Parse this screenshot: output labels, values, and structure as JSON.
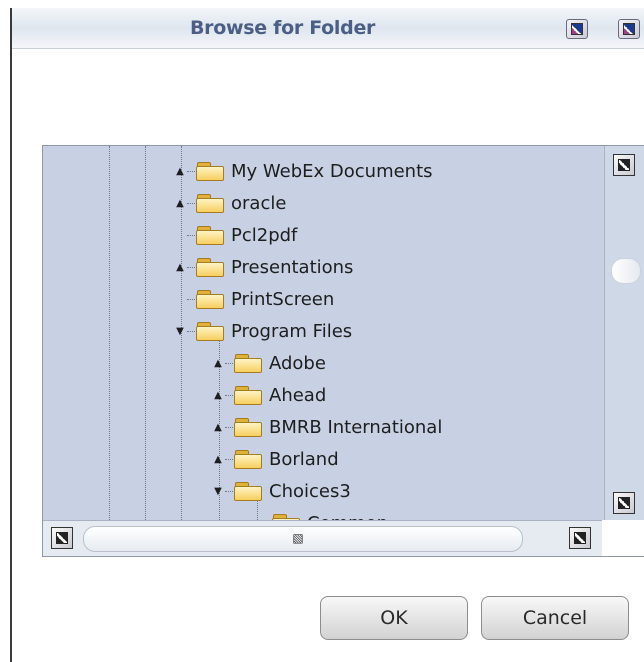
{
  "dialog": {
    "title": "Browse for Folder",
    "titlebar_buttons": [
      "minimize-icon",
      "close-icon"
    ]
  },
  "tree": {
    "items": [
      {
        "label": "My WebEx Documents",
        "depth": 0,
        "expander": "collapsed"
      },
      {
        "label": "oracle",
        "depth": 0,
        "expander": "collapsed"
      },
      {
        "label": "Pcl2pdf",
        "depth": 0,
        "expander": "none"
      },
      {
        "label": "Presentations",
        "depth": 0,
        "expander": "collapsed"
      },
      {
        "label": "PrintScreen",
        "depth": 0,
        "expander": "none"
      },
      {
        "label": "Program Files",
        "depth": 0,
        "expander": "expanded"
      },
      {
        "label": "Adobe",
        "depth": 1,
        "expander": "collapsed"
      },
      {
        "label": "Ahead",
        "depth": 1,
        "expander": "collapsed"
      },
      {
        "label": "BMRB International",
        "depth": 1,
        "expander": "collapsed"
      },
      {
        "label": "Borland",
        "depth": 1,
        "expander": "collapsed"
      },
      {
        "label": "Choices3",
        "depth": 1,
        "expander": "expanded"
      },
      {
        "label": "Common",
        "depth": 2,
        "expander": "none"
      }
    ]
  },
  "buttons": {
    "ok_label": "OK",
    "cancel_label": "Cancel"
  },
  "colors": {
    "title": "#4b5f86",
    "tree_background": "#c7d1e3"
  }
}
